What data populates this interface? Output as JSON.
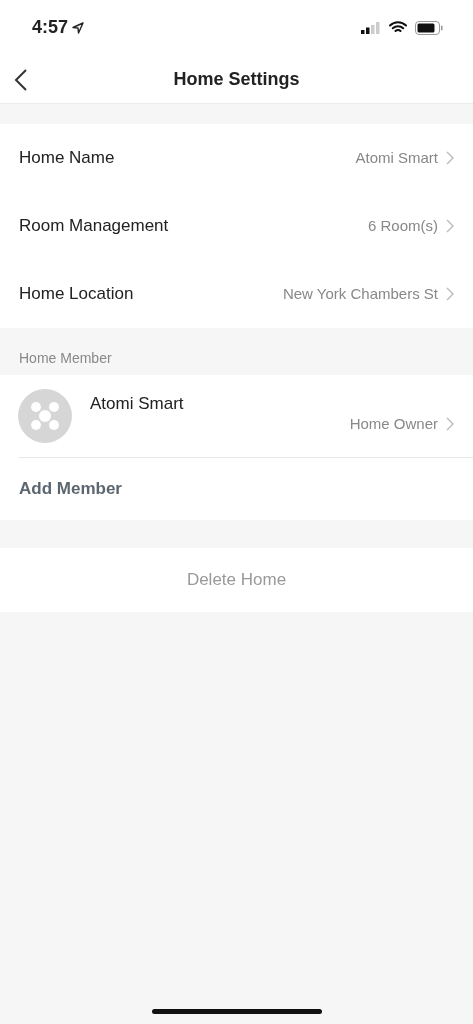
{
  "status_bar": {
    "time": "4:57"
  },
  "header": {
    "title": "Home Settings"
  },
  "settings": [
    {
      "label": "Home Name",
      "value": "Atomi Smart"
    },
    {
      "label": "Room Management",
      "value": "6 Room(s)"
    },
    {
      "label": "Home Location",
      "value": "New York Chambers St"
    }
  ],
  "members_section": {
    "title": "Home Member",
    "members": [
      {
        "name": "Atomi Smart",
        "role": "Home Owner"
      }
    ],
    "add_label": "Add Member"
  },
  "delete_label": "Delete Home"
}
